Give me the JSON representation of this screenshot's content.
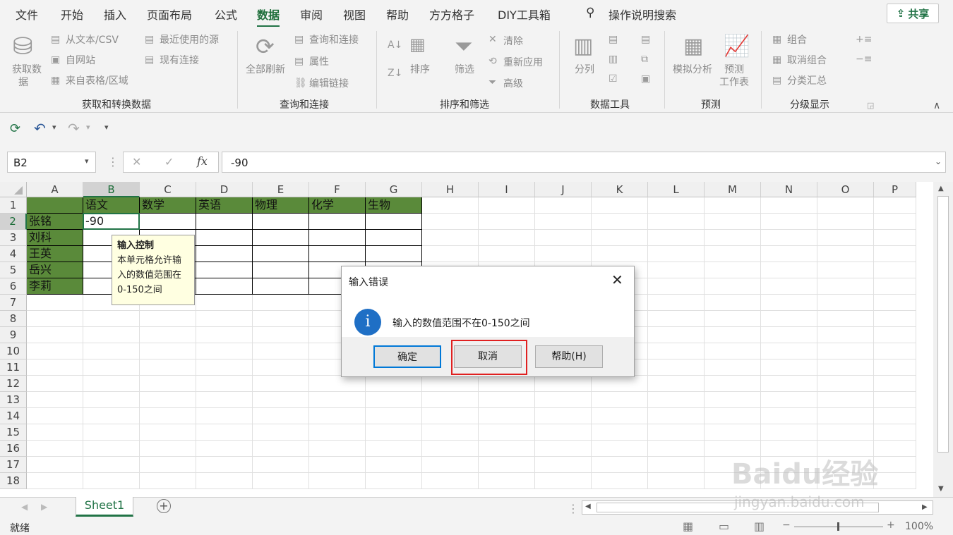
{
  "tabs": [
    "文件",
    "开始",
    "插入",
    "页面布局",
    "公式",
    "数据",
    "审阅",
    "视图",
    "帮助",
    "方方格子",
    "DIY工具箱"
  ],
  "tell_me": "操作说明搜索",
  "share": "共享",
  "ribbon": {
    "get_data": "获取数",
    "get_data2": "据",
    "from_text": "从文本/CSV",
    "from_web": "自网站",
    "from_table": "来自表格/区域",
    "recent": "最近使用的源",
    "existing": "现有连接",
    "refresh_all": "全部刷新",
    "queries": "查询和连接",
    "properties": "属性",
    "edit_links": "编辑链接",
    "sort": "排序",
    "filter": "筛选",
    "clear": "清除",
    "reapply": "重新应用",
    "advanced": "高级",
    "split": "分列",
    "whatif": "模拟分析",
    "forecast": "预测",
    "forecast2": "工作表",
    "group": "组合",
    "ungroup": "取消组合",
    "subtotal": "分类汇总",
    "g1": "获取和转换数据",
    "g2": "查询和连接",
    "g3": "排序和筛选",
    "g4": "数据工具",
    "g5": "预测",
    "g6": "分级显示"
  },
  "namebox": "B2",
  "formula": "-90",
  "columns": [
    "A",
    "B",
    "C",
    "D",
    "E",
    "F",
    "G",
    "H",
    "I",
    "J",
    "K",
    "L",
    "M",
    "N",
    "O",
    "P"
  ],
  "rows": [
    "1",
    "2",
    "3",
    "4",
    "5",
    "6",
    "7",
    "8",
    "9",
    "10",
    "11",
    "12",
    "13",
    "14",
    "15",
    "16",
    "17",
    "18"
  ],
  "headers": [
    "语文",
    "数学",
    "英语",
    "物理",
    "化学",
    "生物"
  ],
  "names": [
    "张铭",
    "刘科",
    "王英",
    "岳兴",
    "李莉"
  ],
  "b2": "-90",
  "tooltip": {
    "title": "输入控制",
    "l1": "本单元格允许输",
    "l2": "入的数值范围在",
    "l3": "0-150之间"
  },
  "dialog": {
    "title": "输入错误",
    "message": "输入的数值范围不在0-150之间",
    "ok": "确定",
    "cancel": "取消",
    "help": "帮助(H)"
  },
  "sheet": "Sheet1",
  "status": "就绪",
  "zoom": "100%",
  "watermark": "Baidu经验",
  "watermark2": "jingyan.baidu.com"
}
